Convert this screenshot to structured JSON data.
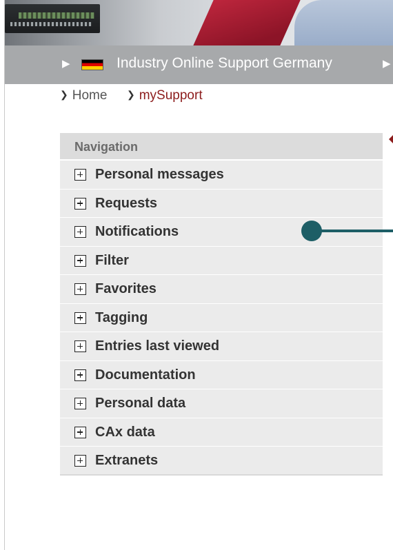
{
  "header": {
    "site_title": "Industry Online Support Germany",
    "country_flag_icon": "flag-germany-icon"
  },
  "breadcrumb": [
    {
      "label": "Home"
    },
    {
      "label": "mySupport"
    }
  ],
  "navigation": {
    "heading": "Navigation",
    "items": [
      {
        "label": "Personal messages"
      },
      {
        "label": "Requests"
      },
      {
        "label": "Notifications"
      },
      {
        "label": "Filter"
      },
      {
        "label": "Favorites"
      },
      {
        "label": "Tagging"
      },
      {
        "label": "Entries last viewed"
      },
      {
        "label": "Documentation"
      },
      {
        "label": "Personal data"
      },
      {
        "label": "CAx data"
      },
      {
        "label": "Extranets"
      }
    ]
  },
  "colors": {
    "topbar": "#a7a9ab",
    "accent_red": "#8c1c1c",
    "annotation": "#1d5e66",
    "nav_item_bg": "#ebebeb",
    "nav_head_bg": "#dcdcdc"
  }
}
